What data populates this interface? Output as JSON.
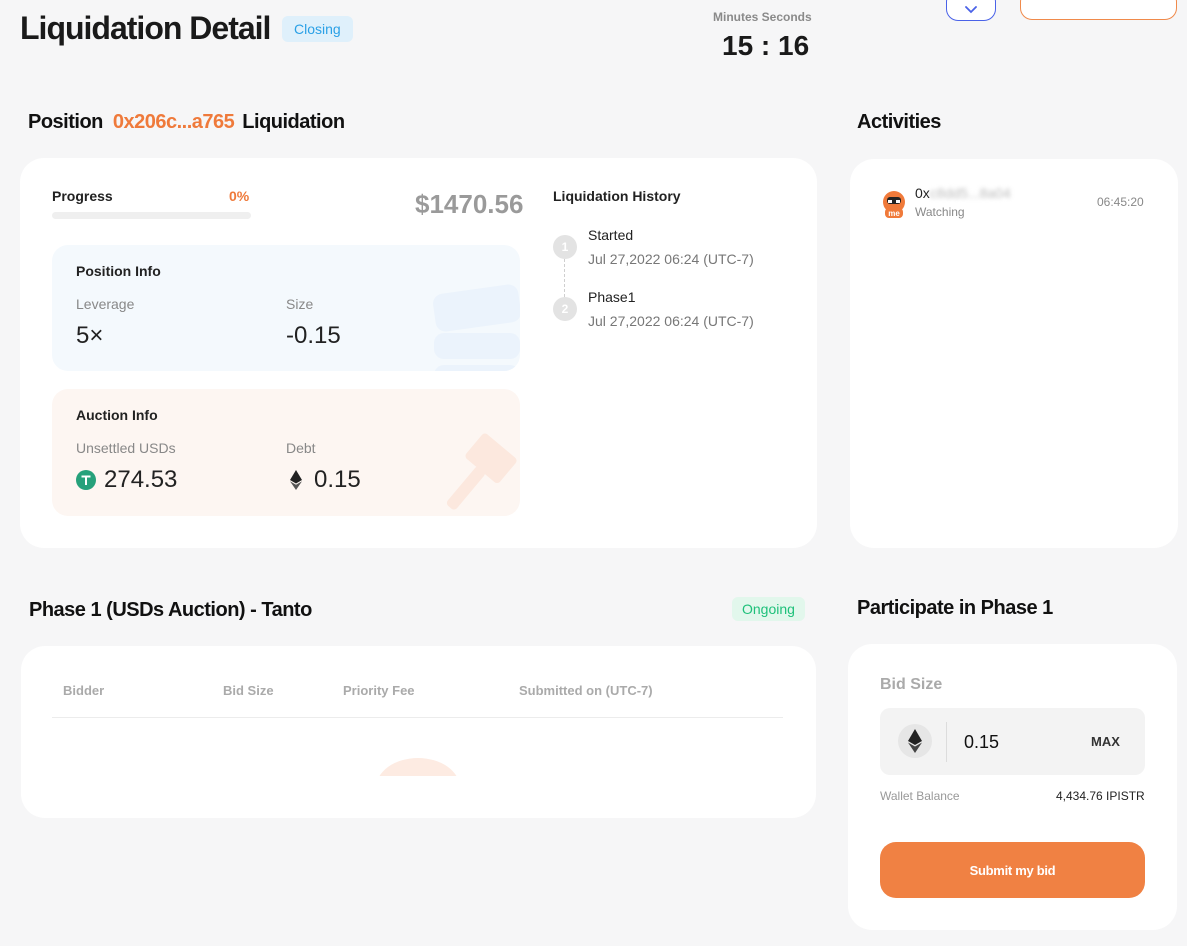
{
  "header": {
    "title": "Liquidation Detail",
    "status": "Closing",
    "timer_label": "Minutes Seconds",
    "timer_value": "15 : 16"
  },
  "position": {
    "title_prefix": "Position",
    "address": "0x206c...a765",
    "title_suffix": "Liquidation",
    "progress_label": "Progress",
    "progress_percent": "0%",
    "progress_value": 0,
    "amount": "$1470.56"
  },
  "position_info": {
    "title": "Position Info",
    "leverage_label": "Leverage",
    "leverage_value": "5×",
    "size_label": "Size",
    "size_value": "-0.15"
  },
  "auction_info": {
    "title": "Auction Info",
    "unsettled_label": "Unsettled USDs",
    "unsettled_value": "274.53",
    "debt_label": "Debt",
    "debt_value": "0.15"
  },
  "history": {
    "title": "Liquidation History",
    "steps": [
      {
        "number": "1",
        "title": "Started",
        "date": "Jul 27,2022 06:24 (UTC-7)"
      },
      {
        "number": "2",
        "title": "Phase1",
        "date": "Jul 27,2022 06:24 (UTC-7)"
      }
    ]
  },
  "activities": {
    "title": "Activities",
    "items": [
      {
        "address_prefix": "0x",
        "address_hidden": "c8dd5...8a04",
        "status": "Watching",
        "time": "06:45:20"
      }
    ]
  },
  "phase": {
    "title": "Phase 1 (USDs Auction) - Tanto",
    "status": "Ongoing",
    "columns": [
      "Bidder",
      "Bid Size",
      "Priority Fee",
      "Submitted on (UTC-7)"
    ]
  },
  "participate": {
    "title": "Participate in Phase 1",
    "bid_label": "Bid Size",
    "bid_value": "0.15",
    "max_label": "MAX",
    "wallet_label": "Wallet Balance",
    "wallet_value": "4,434.76 IPISTR",
    "submit_label": "Submit my bid"
  },
  "colors": {
    "accent": "#ef7a3b",
    "closing": "#2aa0e6",
    "ongoing": "#1ec07a",
    "tether": "#26a17b"
  }
}
